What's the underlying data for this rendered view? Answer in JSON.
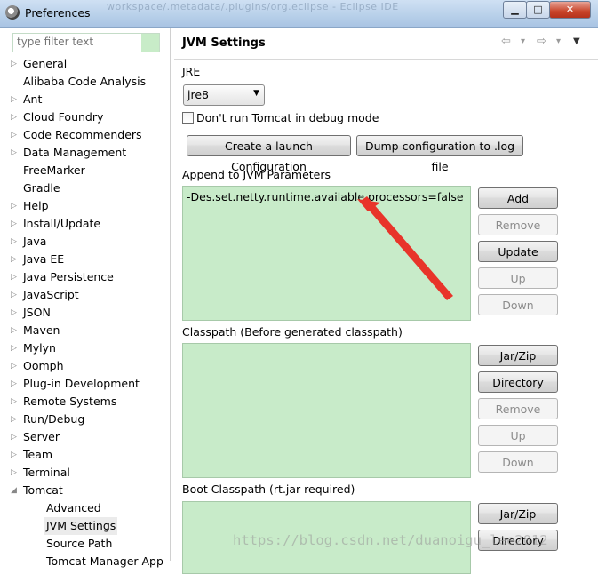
{
  "window": {
    "title": "Preferences",
    "background_title": "workspace/.metadata/.plugins/org.eclipse - Eclipse IDE",
    "buttons": {
      "minimize": "▁",
      "maximize": "□",
      "close": "✕"
    }
  },
  "filter": {
    "placeholder": "type filter text",
    "value": ""
  },
  "tree": [
    {
      "label": "General",
      "arrow": "▷"
    },
    {
      "label": "Alibaba Code Analysis",
      "arrow": ""
    },
    {
      "label": "Ant",
      "arrow": "▷"
    },
    {
      "label": "Cloud Foundry",
      "arrow": "▷"
    },
    {
      "label": "Code Recommenders",
      "arrow": "▷"
    },
    {
      "label": "Data Management",
      "arrow": "▷"
    },
    {
      "label": "FreeMarker",
      "arrow": ""
    },
    {
      "label": "Gradle",
      "arrow": ""
    },
    {
      "label": "Help",
      "arrow": "▷"
    },
    {
      "label": "Install/Update",
      "arrow": "▷"
    },
    {
      "label": "Java",
      "arrow": "▷"
    },
    {
      "label": "Java EE",
      "arrow": "▷"
    },
    {
      "label": "Java Persistence",
      "arrow": "▷"
    },
    {
      "label": "JavaScript",
      "arrow": "▷"
    },
    {
      "label": "JSON",
      "arrow": "▷"
    },
    {
      "label": "Maven",
      "arrow": "▷"
    },
    {
      "label": "Mylyn",
      "arrow": "▷"
    },
    {
      "label": "Oomph",
      "arrow": "▷"
    },
    {
      "label": "Plug-in Development",
      "arrow": "▷"
    },
    {
      "label": "Remote Systems",
      "arrow": "▷"
    },
    {
      "label": "Run/Debug",
      "arrow": "▷"
    },
    {
      "label": "Server",
      "arrow": "▷"
    },
    {
      "label": "Team",
      "arrow": "▷"
    },
    {
      "label": "Terminal",
      "arrow": "▷"
    },
    {
      "label": "Tomcat",
      "arrow": "◢"
    },
    {
      "label": "Advanced",
      "arrow": "",
      "child": true
    },
    {
      "label": "JVM Settings",
      "arrow": "",
      "child": true,
      "selected": true
    },
    {
      "label": "Source Path",
      "arrow": "",
      "child": true
    },
    {
      "label": "Tomcat Manager App",
      "arrow": "",
      "child": true
    }
  ],
  "page": {
    "title": "JVM Settings",
    "nav": {
      "back": "⇦",
      "back_menu": "▾",
      "forward": "⇨",
      "forward_menu": "▾",
      "view_menu": "▼"
    },
    "jre_label": "JRE",
    "jre_value": "jre8",
    "jre_drop": "▼",
    "debug_checkbox": {
      "label": "Don't run Tomcat in debug mode",
      "checked": false
    },
    "create_launch_button": "Create a launch Configuration",
    "dump_config_button": "Dump configuration to .log file",
    "jvm_params": {
      "label": "Append to JVM Parameters",
      "items": [
        "-Des.set.netty.runtime.available.processors=false"
      ],
      "buttons": {
        "add": "Add",
        "remove": "Remove",
        "update": "Update",
        "up": "Up",
        "down": "Down"
      }
    },
    "classpath": {
      "label": "Classpath (Before generated classpath)",
      "buttons": {
        "jar_zip": "Jar/Zip",
        "directory": "Directory",
        "remove": "Remove",
        "up": "Up",
        "down": "Down"
      }
    },
    "boot_classpath": {
      "label": "Boot Classpath (rt.jar required)",
      "buttons": {
        "jar_zip": "Jar/Zip",
        "directory": "Directory"
      }
    }
  },
  "annotation": {
    "arrow_color": "#e8342a"
  },
  "watermark": "https://blog.csdn.net/duanoigu_lee2012"
}
